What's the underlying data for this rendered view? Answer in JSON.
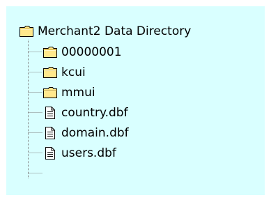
{
  "tree": {
    "root": {
      "label": "Merchant2 Data Directory",
      "icon": "folder-icon"
    },
    "children": [
      {
        "label": "00000001",
        "icon": "folder-icon",
        "type": "folder"
      },
      {
        "label": "kcui",
        "icon": "folder-icon",
        "type": "folder"
      },
      {
        "label": "mmui",
        "icon": "folder-icon",
        "type": "folder"
      },
      {
        "label": "country.dbf",
        "icon": "file-icon",
        "type": "file"
      },
      {
        "label": "domain.dbf",
        "icon": "file-icon",
        "type": "file"
      },
      {
        "label": "users.dbf",
        "icon": "file-icon",
        "type": "file"
      }
    ]
  },
  "colors": {
    "panel_background": "#d9ffff",
    "folder_yellow": "#ffe88c",
    "folder_outline": "#000000",
    "tree_line": "#808080"
  }
}
